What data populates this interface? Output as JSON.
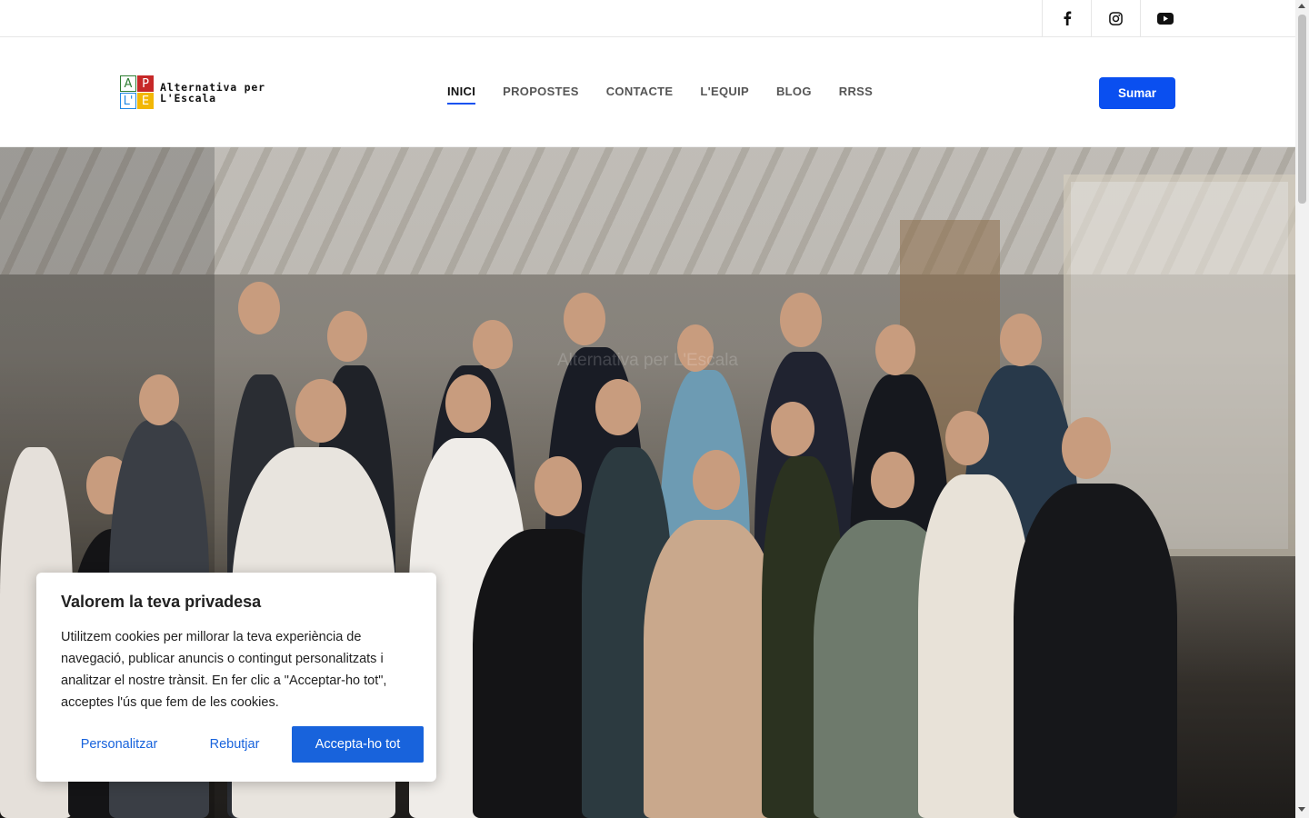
{
  "social": {
    "icons": [
      "facebook-icon",
      "instagram-icon",
      "youtube-icon"
    ]
  },
  "logo": {
    "letters": [
      "A",
      "P",
      "L'",
      "E"
    ],
    "line1": "Alternativa per",
    "line2": "L'Escala"
  },
  "nav": {
    "items": [
      "INICI",
      "PROPOSTES",
      "CONTACTE",
      "L'EQUIP",
      "BLOG",
      "RRSS"
    ],
    "active": "INICI"
  },
  "header": {
    "cta_label": "Sumar"
  },
  "hero": {
    "title": "Alternativa per L'Escala"
  },
  "cookie": {
    "title": "Valorem la teva privadesa",
    "text": "Utilitzem cookies per millorar la teva experiència de navegació, publicar anuncis o contingut personalitzats i analitzar el nostre trànsit. En fer clic a \"Acceptar-ho tot\", acceptes l'ús que fem de les cookies.",
    "customize_label": "Personalitzar",
    "reject_label": "Rebutjar",
    "accept_label": "Accepta-ho tot"
  },
  "colors": {
    "accent": "#0a4ff0",
    "cookie_accent": "#1863dc"
  }
}
